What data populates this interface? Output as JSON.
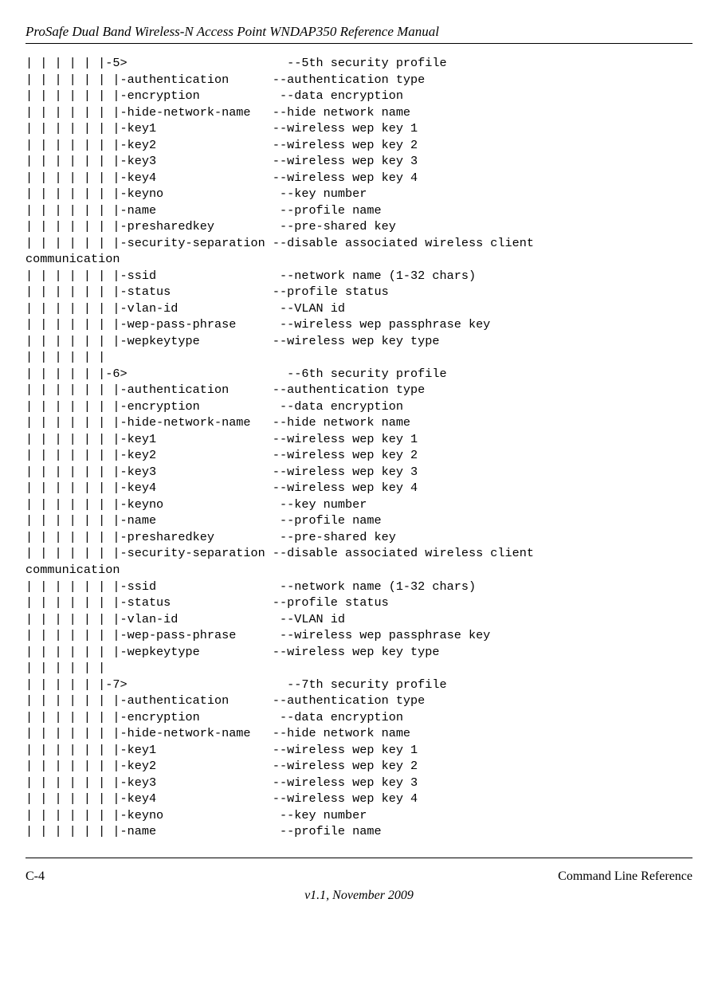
{
  "header": {
    "title": "ProSafe Dual Band Wireless-N Access Point WNDAP350 Reference Manual"
  },
  "body": {
    "text": "| | | | | |-5>                      --5th security profile\n| | | | | | |-authentication      --authentication type\n| | | | | | |-encryption           --data encryption\n| | | | | | |-hide-network-name   --hide network name\n| | | | | | |-key1                --wireless wep key 1\n| | | | | | |-key2                --wireless wep key 2\n| | | | | | |-key3                --wireless wep key 3\n| | | | | | |-key4                --wireless wep key 4\n| | | | | | |-keyno                --key number\n| | | | | | |-name                 --profile name\n| | | | | | |-presharedkey         --pre-shared key\n| | | | | | |-security-separation --disable associated wireless client\ncommunication\n| | | | | | |-ssid                 --network name (1-32 chars)\n| | | | | | |-status              --profile status\n| | | | | | |-vlan-id              --VLAN id\n| | | | | | |-wep-pass-phrase      --wireless wep passphrase key\n| | | | | | |-wepkeytype          --wireless wep key type\n| | | | | |\n| | | | | |-6>                      --6th security profile\n| | | | | | |-authentication      --authentication type\n| | | | | | |-encryption           --data encryption\n| | | | | | |-hide-network-name   --hide network name\n| | | | | | |-key1                --wireless wep key 1\n| | | | | | |-key2                --wireless wep key 2\n| | | | | | |-key3                --wireless wep key 3\n| | | | | | |-key4                --wireless wep key 4\n| | | | | | |-keyno                --key number\n| | | | | | |-name                 --profile name\n| | | | | | |-presharedkey         --pre-shared key\n| | | | | | |-security-separation --disable associated wireless client\ncommunication\n| | | | | | |-ssid                 --network name (1-32 chars)\n| | | | | | |-status              --profile status\n| | | | | | |-vlan-id              --VLAN id\n| | | | | | |-wep-pass-phrase      --wireless wep passphrase key\n| | | | | | |-wepkeytype          --wireless wep key type\n| | | | | |\n| | | | | |-7>                      --7th security profile\n| | | | | | |-authentication      --authentication type\n| | | | | | |-encryption           --data encryption\n| | | | | | |-hide-network-name   --hide network name\n| | | | | | |-key1                --wireless wep key 1\n| | | | | | |-key2                --wireless wep key 2\n| | | | | | |-key3                --wireless wep key 3\n| | | | | | |-key4                --wireless wep key 4\n| | | | | | |-keyno                --key number\n| | | | | | |-name                 --profile name"
  },
  "footer": {
    "page": "C-4",
    "section": "Command Line Reference",
    "version": "v1.1, November 2009"
  }
}
